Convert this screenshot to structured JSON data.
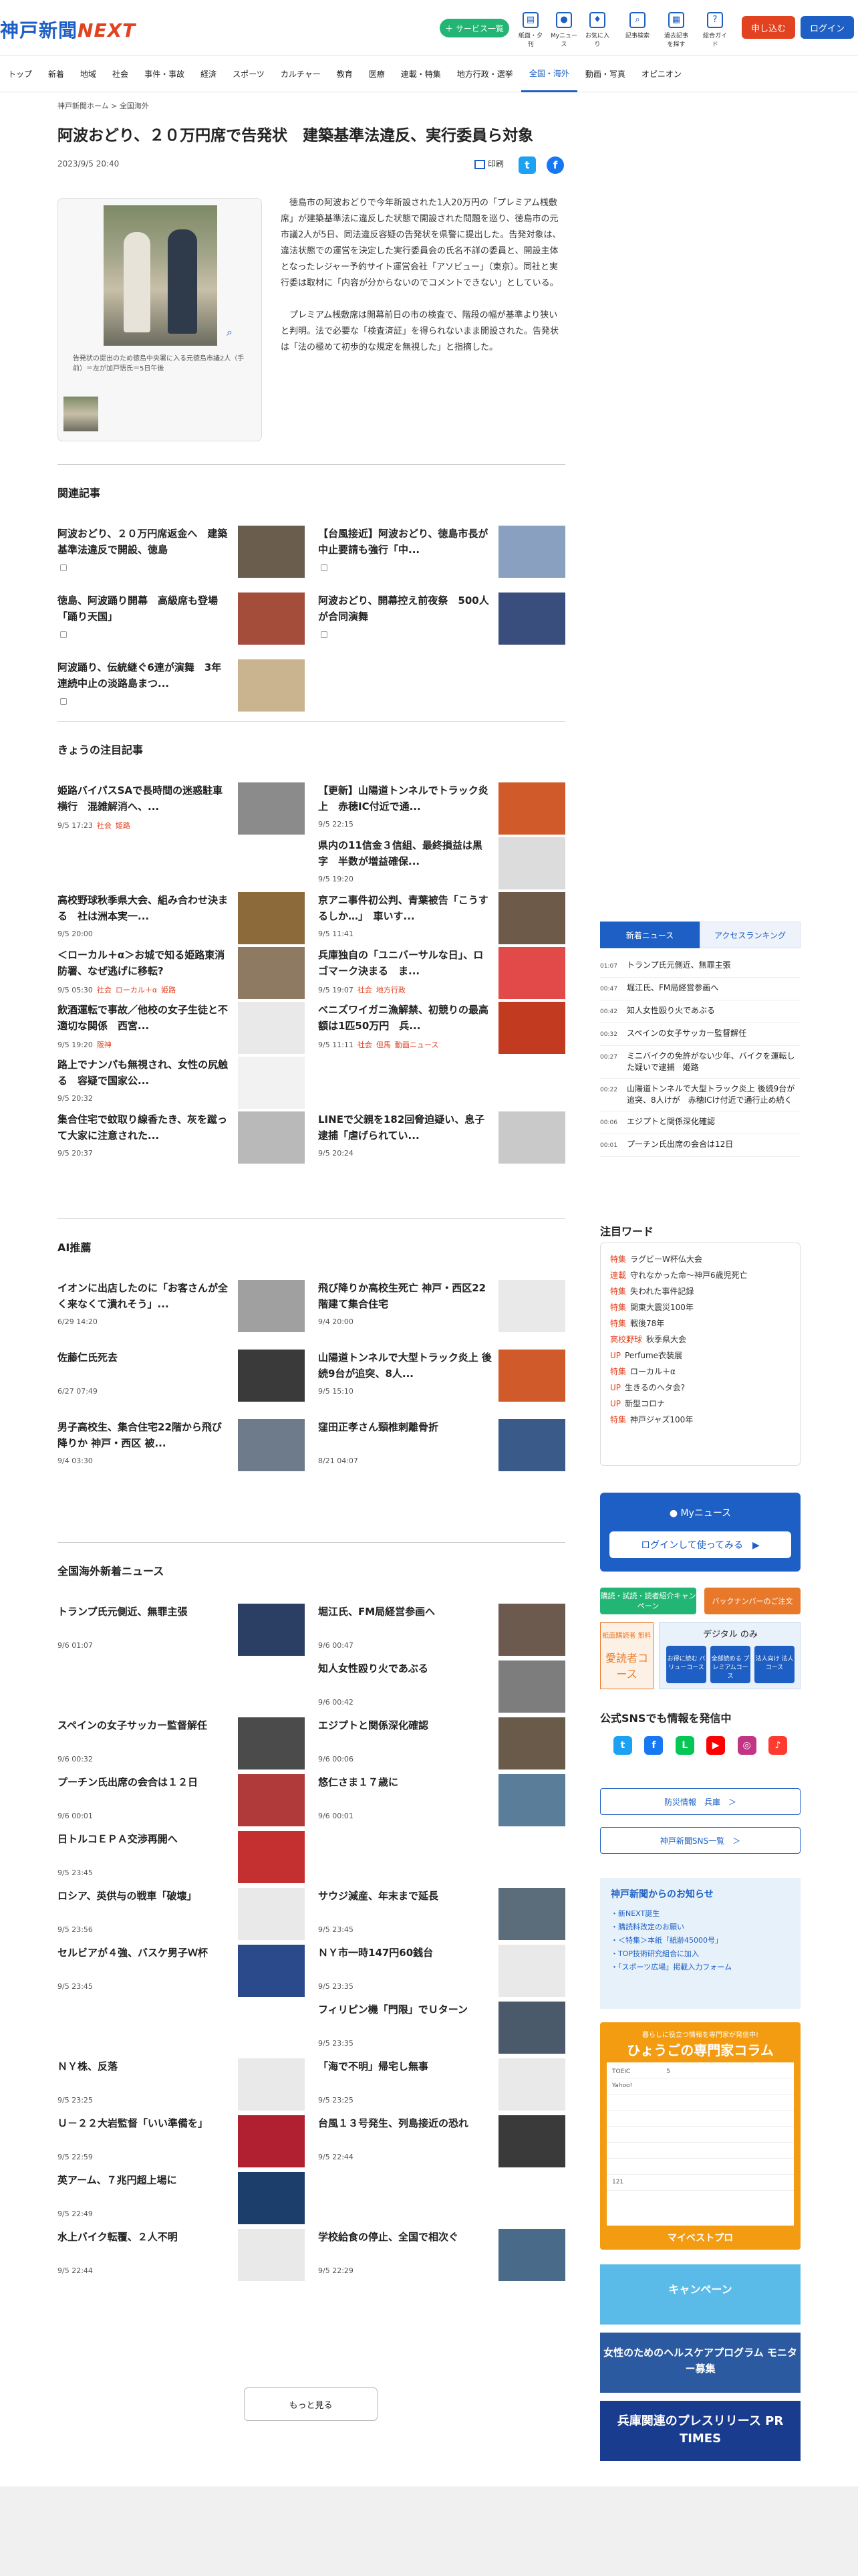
{
  "header": {
    "logo": "神戸新聞",
    "logo_accent": "NEXT",
    "service_pill": "サービス一覧",
    "icons": [
      {
        "label": "紙面・夕刊",
        "icon": "newspaper-icon"
      },
      {
        "label": "Myニュース",
        "icon": "person-icon"
      },
      {
        "label": "お気に入り",
        "icon": "pin-icon"
      },
      {
        "label": "記事検索",
        "icon": "search-icon"
      },
      {
        "label": "過去記事を探す",
        "icon": "archive-icon"
      },
      {
        "label": "総合ガイド",
        "icon": "help-icon"
      }
    ],
    "signup": "申し込む",
    "login": "ログイン"
  },
  "nav": [
    "トップ",
    "新着",
    "地域",
    "社会",
    "事件・事故",
    "経済",
    "スポーツ",
    "カルチャー",
    "教育",
    "医療",
    "連載・特集",
    "地方行政・選挙",
    "全国・海外",
    "動画・写真",
    "オピニオン"
  ],
  "nav_active": "全国・海外",
  "breadcrumb": {
    "home": "神戸新聞ホーム",
    "sep": ">",
    "current": "全国海外"
  },
  "article": {
    "title": "阿波おどり、２０万円席で告発状　建築基準法違反、実行委員ら対象",
    "date": "2023/9/5 20:40",
    "print": "印刷",
    "caption": "告発状の提出のため徳島中央署に入る元徳島市議2人（手前）＝左が加戸悟氏＝5日午後",
    "paragraphs": [
      "徳島市の阿波おどりで今年新設された1人20万円の「プレミアム桟敷席」が建築基準法に違反した状態で開設された問題を巡り、徳島市の元市議2人が5日、同法違反容疑の告発状を県警に提出した。告発対象は、違法状態での運営を決定した実行委員会の氏名不詳の委員と、開設主体となったレジャー予約サイト運営会社「アソビュー」（東京）。同社と実行委は取材に「内容が分からないのでコメントできない」としている。",
      "プレミアム桟敷席は開幕前日の市の検査で、階段の幅が基準より狭いと判明。法で必要な「検査済証」を得られないまま開設された。告発状は「法の極めて初歩的な規定を無視した」と指摘した。"
    ]
  },
  "related": {
    "title": "関連記事",
    "items": [
      {
        "title": "阿波おどり、２０万円席返金へ　建築基準法違反で開設、徳島",
        "img": "#6b5d4d"
      },
      {
        "title": "【台風接近】阿波おどり、徳島市長が中止要請も強行「中...",
        "img": "#8aa0c0"
      },
      {
        "title": "徳島、阿波踊り開幕　高級席も登場「踊り天国」",
        "img": "#a34d3a"
      },
      {
        "title": "阿波おどり、開幕控え前夜祭　500人が合同演舞",
        "img": "#3a4e7d"
      },
      {
        "title": "阿波踊り、伝統継ぐ6連が演舞　3年連続中止の淡路島まつ...",
        "img": "#c9b48f"
      }
    ]
  },
  "today": {
    "title": "きょうの注目記事",
    "items": [
      {
        "title": "姫路バイパスSAで長時間の迷惑駐車横行　混雑解消へ、...",
        "date": "9/5 17:23",
        "tags": [
          "社会",
          "姫路"
        ],
        "img": "#8b8b8b"
      },
      {
        "title": "【更新】山陽道トンネルでトラック炎上　赤穂IC付近で通...",
        "date": "9/5 22:15",
        "tags": [],
        "img": "#d05a2a"
      },
      {
        "title": "",
        "date": "",
        "tags": [],
        "img": ""
      },
      {
        "title": "県内の11信金３信組、最終損益は黒字　半数が増益確保...",
        "date": "9/5 19:20",
        "tags": [],
        "img": "#dcdcdc"
      },
      {
        "title": "高校野球秋季県大会、組み合わせ決まる　社は洲本実一...",
        "date": "9/5 20:00",
        "tags": [],
        "img": "#8c6a3a"
      },
      {
        "title": "京アニ事件初公判、青葉被告「こうするしか…」　車いす...",
        "date": "9/5 11:41",
        "tags": [],
        "img": "#6d5a48"
      },
      {
        "title": "＜ローカル＋α＞お城で知る姫路東消防署、なぜ逃げに移転?",
        "date": "9/5 05:30",
        "tags": [
          "社会",
          "ローカル＋α",
          "姫路"
        ],
        "img": "#8e7a63"
      },
      {
        "title": "兵庫独自の「ユニバーサルな日」、ロゴマーク決まる　ま...",
        "date": "9/5 19:07",
        "tags": [
          "社会",
          "地方行政"
        ],
        "img": "#e24a4a"
      },
      {
        "title": "飲酒運転で事故／他校の女子生徒と不適切な関係　西宮...",
        "date": "9/5 19:20",
        "tags": [
          "阪神"
        ],
        "img": "#e9e9e9"
      },
      {
        "title": "ベニズワイガニ漁解禁、初競りの最高額は1匹50万円　兵...",
        "date": "9/5 11:11",
        "tags": [
          "社会",
          "但馬",
          "動画ニュース"
        ],
        "img": "#c23a1f"
      },
      {
        "title": "路上でナンパも無視され、女性の尻触る　容疑で国家公...",
        "date": "9/5 20:32",
        "tags": [],
        "img": "#f2f2f2"
      },
      {
        "title": "",
        "date": "",
        "tags": [],
        "img": ""
      },
      {
        "title": "集合住宅で蚊取り線香たき、灰を蹴って大家に注意された...",
        "date": "9/5 20:37",
        "tags": [],
        "img": "#b9b9b9"
      },
      {
        "title": "LINEで父親を182回脅迫疑い、息子逮捕「虐げられてい...",
        "date": "9/5 20:24",
        "tags": [],
        "img": "#c9c9c9"
      }
    ]
  },
  "ai": {
    "title": "AI推薦",
    "items": [
      {
        "title": "イオンに出店したのに「お客さんが全く来なくて潰れそう」...",
        "date": "6/29 14:20",
        "img": "#a0a0a0"
      },
      {
        "title": "飛び降りか高校生死亡 神戸・西区22階建て集合住宅",
        "date": "9/4 20:00",
        "img": "placeholder"
      },
      {
        "title": "佐藤仁氏死去",
        "date": "6/27 07:49",
        "img": "#3a3a3a"
      },
      {
        "title": "山陽道トンネルで大型トラック炎上 後続9台が追突、8人...",
        "date": "9/5 15:10",
        "img": "#d05a2a"
      },
      {
        "title": "男子高校生、集合住宅22階から飛び降りか 神戸・西区 被...",
        "date": "9/4 03:30",
        "img": "#6e7b8b"
      },
      {
        "title": "窪田正孝さん頸椎刺離骨折",
        "date": "8/21 04:07",
        "img": "#3a5a8a"
      }
    ]
  },
  "national": {
    "title": "全国海外新着ニュース",
    "items": [
      {
        "title": "トランプ氏元側近、無罪主張",
        "date": "9/6 01:07",
        "img": "#2b3e63"
      },
      {
        "title": "堀江氏、FM局経営参画へ",
        "date": "9/6 00:47",
        "img": "#6b5a4d"
      },
      {
        "title": "",
        "date": "",
        "img": ""
      },
      {
        "title": "知人女性殴り火であぶる",
        "date": "9/6 00:42",
        "img": "#7d7d7d"
      },
      {
        "title": "スペインの女子サッカー監督解任",
        "date": "9/6 00:32",
        "img": "#4b4b4b"
      },
      {
        "title": "エジプトと関係深化確認",
        "date": "9/6 00:06",
        "img": "#6a5a4a"
      },
      {
        "title": "プーチン氏出席の会合は１２日",
        "date": "9/6 00:01",
        "img": "#b03a3a"
      },
      {
        "title": "悠仁さま１７歳に",
        "date": "9/6 00:01",
        "img": "#5a7d9a"
      },
      {
        "title": "日トルコＥＰＡ交渉再開へ",
        "date": "9/5 23:45",
        "img": "#c43030"
      },
      {
        "title": "",
        "date": "",
        "img": ""
      },
      {
        "title": "ロシア、英供与の戦車「破壊」",
        "date": "9/5 23:56",
        "img": "placeholder"
      },
      {
        "title": "サウジ減産、年末まで延長",
        "date": "9/5 23:45",
        "img": "#5b6d7b"
      },
      {
        "title": "セルビアが４強、バスケ男子Ｗ杯",
        "date": "9/5 23:45",
        "img": "#2b4a8b"
      },
      {
        "title": "ＮＹ市一時147円60銭台",
        "date": "9/5 23:35",
        "img": "placeholder"
      },
      {
        "title": "",
        "date": "",
        "img": ""
      },
      {
        "title": "フィリピン機「門限」でＵターン",
        "date": "9/5 23:35",
        "img": "#4a5a6a"
      },
      {
        "title": "ＮＹ株、反落",
        "date": "9/5 23:25",
        "img": "placeholder"
      },
      {
        "title": "「海で不明」帰宅し無事",
        "date": "9/5 23:25",
        "img": "placeholder"
      },
      {
        "title": "Ｕ－２２大岩監督「いい準備を」",
        "date": "9/5 22:59",
        "img": "#b02030"
      },
      {
        "title": "台風１３号発生、列島接近の恐れ",
        "date": "9/5 22:44",
        "img": "#3a3a3a"
      },
      {
        "title": "英アーム、７兆円超上場に",
        "date": "9/5 22:49",
        "img": "#1b3e6b"
      },
      {
        "title": "",
        "date": "",
        "img": ""
      },
      {
        "title": "水上バイク転覆、２人不明",
        "date": "9/5 22:44",
        "img": "placeholder"
      },
      {
        "title": "学校給食の停止、全国で相次ぐ",
        "date": "9/5 22:29",
        "img": "#4a6a8a"
      }
    ]
  },
  "more": "もっと見る",
  "sidebar": {
    "tabs": [
      "新着ニュース",
      "アクセスランキング"
    ],
    "rank": [
      {
        "time": "01:07",
        "title": "トランプ氏元側近、無罪主張"
      },
      {
        "time": "00:47",
        "title": "堀江氏、FM局経営参画へ"
      },
      {
        "time": "00:42",
        "title": "知人女性殴り火であぶる"
      },
      {
        "time": "00:32",
        "title": "スペインの女子サッカー監督解任"
      },
      {
        "time": "00:27",
        "title": "ミニバイクの免許がない少年、バイクを運転した疑いで逮捕　姫路"
      },
      {
        "time": "00:22",
        "title": "山陽道トンネルで大型トラック炎上 後続9台が追突、8人けが　赤穂ICけ付近で通行止め続く"
      },
      {
        "time": "00:06",
        "title": "エジプトと関係深化確認"
      },
      {
        "time": "00:01",
        "title": "プーチン氏出席の会合は12日"
      }
    ],
    "keyword_title": "注目ワード",
    "keywords": [
      {
        "tag": "特集",
        "text": "ラグビーW杯仏大会"
      },
      {
        "tag": "連載",
        "text": "守れなかった命～神戸6歳児死亡"
      },
      {
        "tag": "特集",
        "text": "失われた事件記録"
      },
      {
        "tag": "特集",
        "text": "関東大震災100年"
      },
      {
        "tag": "特集",
        "text": "戦後78年"
      },
      {
        "tag": "高校野球",
        "text": "秋季県大会"
      },
      {
        "tag": "UP",
        "text": "Perfume衣装展"
      },
      {
        "tag": "特集",
        "text": "ローカル＋α"
      },
      {
        "tag": "UP",
        "text": "生きるのヘタ会?"
      },
      {
        "tag": "UP",
        "text": "新型コロナ"
      },
      {
        "tag": "特集",
        "text": "神戸ジャズ100年"
      }
    ],
    "mynews_title": "Myニュース",
    "mynews_btn": "ログインして使ってみる　▶",
    "green_btn": "購読・試読・読者紹介キャンペーン",
    "orange_btn": "バックナンバーのご注文",
    "sub_label1": "紙面購読者 無料",
    "sub_big": "愛読者コース",
    "sub_label2": "デジタル のみ",
    "sub_caps": [
      "お得に読む バリューコース",
      "全部読める プレミアムコース",
      "法人向け 法人コース"
    ],
    "sns_title": "公式SNSでも情報を発信中",
    "sns": [
      {
        "name": "twitter-icon",
        "glyph": "t",
        "color": "#1da1f2"
      },
      {
        "name": "facebook-icon",
        "glyph": "f",
        "color": "#1877f2"
      },
      {
        "name": "line-icon",
        "glyph": "L",
        "color": "#06c755"
      },
      {
        "name": "youtube-icon",
        "glyph": "▶",
        "color": "#ff0000"
      },
      {
        "name": "instagram-icon",
        "glyph": "◎",
        "color": "#c13584"
      },
      {
        "name": "tiktok-icon",
        "glyph": "♪",
        "color": "#ff3b30"
      }
    ],
    "disaster_btn": "防災情報　兵庫　＞",
    "sns_list_btn": "神戸新聞SNS一覧　＞",
    "notice_title": "神戸新聞からのお知らせ",
    "notices": [
      "・新NEXT誕生",
      "・購読料改定のお願い",
      "・＜特集＞本紙「紙齢45000号」",
      "・TOP技術研究組合に加入",
      "・「スポーツ広場」掲載入力フォーム"
    ],
    "column_small": "暮らしに役立つ情報を専門家が発信中!",
    "column_title": "ひょうごの専門家コラム",
    "column_rows": [
      "TOEIC　　　　　　5",
      "Yahoo!",
      "",
      "",
      "",
      "",
      "",
      "121"
    ],
    "column_bottom": "マイベストプロ",
    "banner1": "キャンペーン",
    "banner2": "女性のためのヘルスケアプログラム モニター募集",
    "banner3": "兵庫関連のプレスリリース PR TIMES"
  }
}
